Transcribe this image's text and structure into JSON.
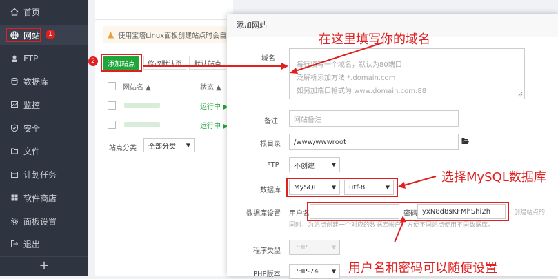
{
  "sidebar": {
    "items": [
      {
        "label": "首页",
        "icon": "home-icon"
      },
      {
        "label": "网站",
        "icon": "globe-icon"
      },
      {
        "label": "FTP",
        "icon": "ftp-icon"
      },
      {
        "label": "数据库",
        "icon": "database-icon"
      },
      {
        "label": "监控",
        "icon": "monitor-icon"
      },
      {
        "label": "安全",
        "icon": "shield-icon"
      },
      {
        "label": "文件",
        "icon": "folder-icon"
      },
      {
        "label": "计划任务",
        "icon": "calendar-icon"
      },
      {
        "label": "软件商店",
        "icon": "grid-icon"
      },
      {
        "label": "面板设置",
        "icon": "settings-icon"
      },
      {
        "label": "退出",
        "icon": "logout-icon"
      }
    ],
    "add_symbol": "+"
  },
  "main": {
    "warning_text": "使用宝塔Linux面板创建站点时会自动",
    "buttons": {
      "add_site": "添加站点",
      "modify_default": "修改默认页",
      "default_site": "默认站点"
    },
    "table": {
      "col_name": "网站名 ▲",
      "col_status": "状态 ▲",
      "status_running": "运行中 ▶"
    },
    "category_label": "站点分类",
    "category_select": "全部分类"
  },
  "badges": {
    "one": "1",
    "two": "2"
  },
  "modal": {
    "title": "添加网站",
    "domain_label": "域名",
    "domain_placeholder": [
      "每行填写一个域名，默认为80端口",
      "泛解析添加方法 *.domain.com",
      "如另加端口格式为 www.domain.com:88"
    ],
    "remark_label": "备注",
    "remark_placeholder": "网站备注",
    "root_label": "根目录",
    "root_value": "/www/wwwroot",
    "ftp_label": "FTP",
    "ftp_value": "不创建",
    "db_label": "数据库",
    "db_type": "MySQL",
    "db_charset": "utf-8",
    "dbset_label": "数据库设置",
    "user_label": "用户名",
    "user_value": "",
    "pwd_label": "密码",
    "pwd_value": "yxN8d8sKFMhShi2h",
    "db_hint_right": "创建站点的",
    "db_hint": "同时，为站点创建一个对应的数据库帐户，方便不同站点使用不同数据库。",
    "lang_label": "程序类型",
    "lang_value": "PHP",
    "php_label": "PHP版本",
    "php_value": "PHP-74"
  },
  "annotations": {
    "domain": "在这里填写你的域名",
    "mysql": "选择MySQL数据库",
    "userpwd": "用户名和密码可以随便设置"
  },
  "colors": {
    "annotation": "#e02020",
    "brand_green": "#20a53a",
    "sidebar_bg": "#2e3440"
  }
}
